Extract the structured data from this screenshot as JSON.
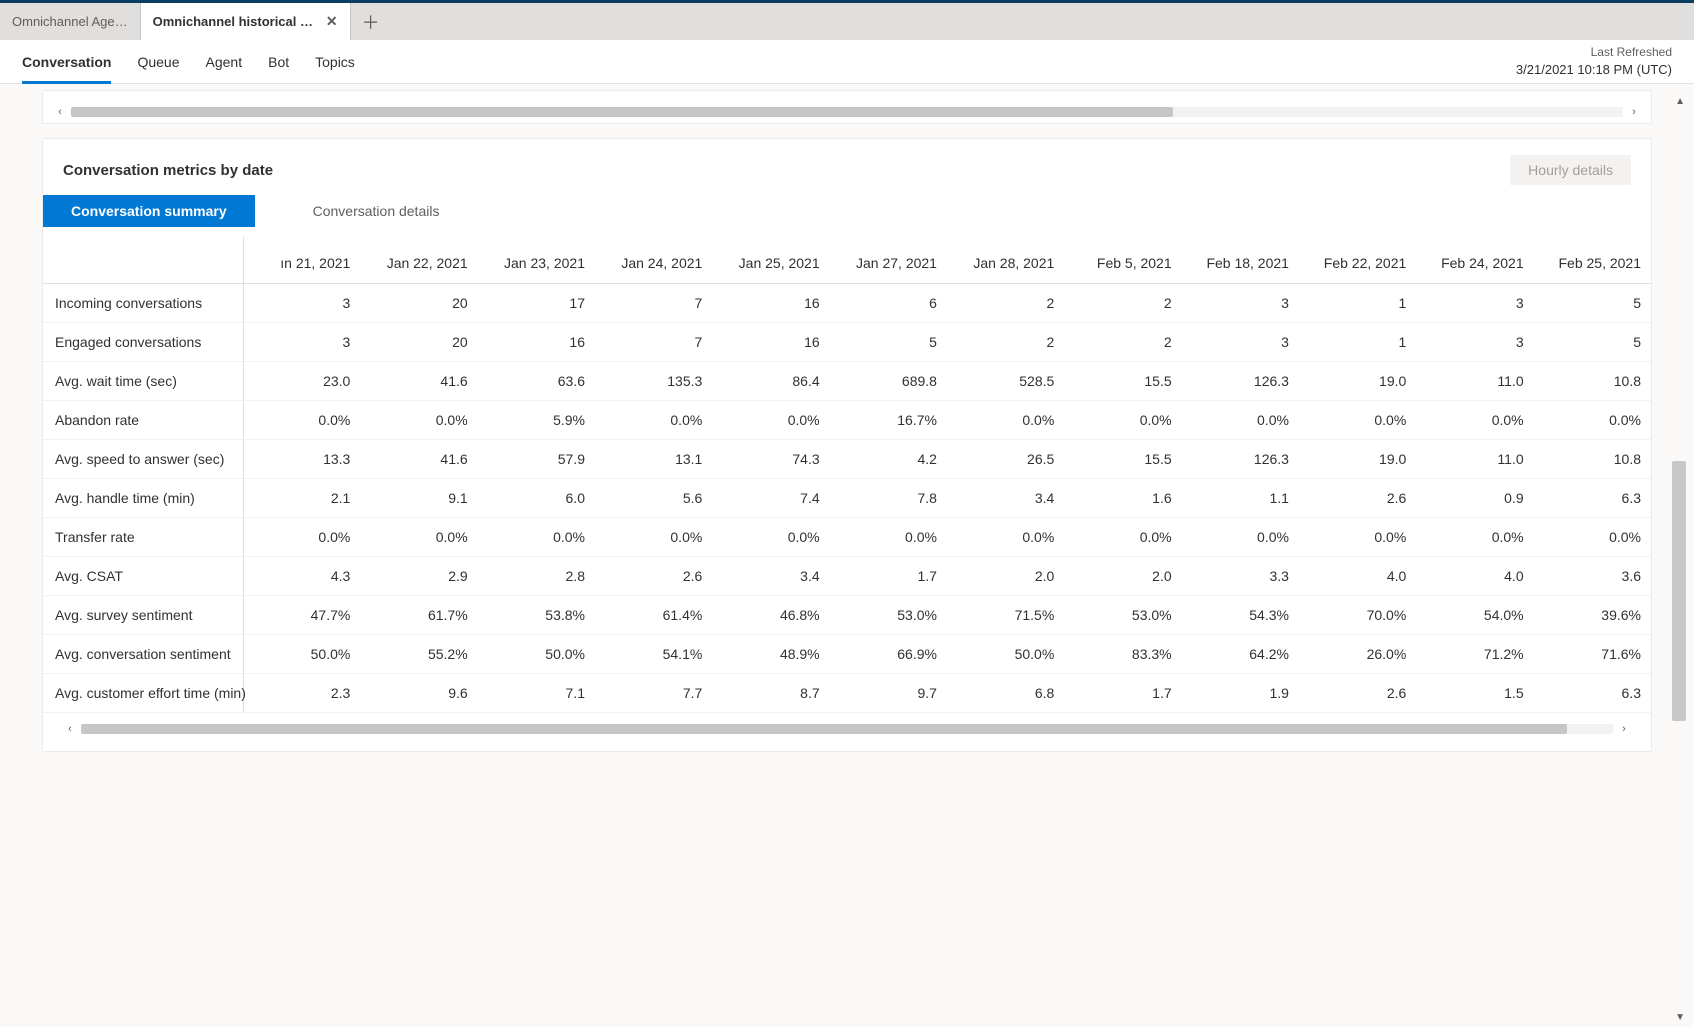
{
  "tabs": [
    {
      "label": "Omnichannel Age…",
      "active": false,
      "closable": false
    },
    {
      "label": "Omnichannel historical an…",
      "active": true,
      "closable": true
    }
  ],
  "nav": {
    "items": [
      "Conversation",
      "Queue",
      "Agent",
      "Bot",
      "Topics"
    ],
    "activeIndex": 0,
    "refreshLabel": "Last Refreshed",
    "refreshTime": "3/21/2021 10:18 PM (UTC)"
  },
  "card": {
    "title": "Conversation metrics by date",
    "hourlyButton": "Hourly details",
    "pivots": [
      "Conversation summary",
      "Conversation details"
    ],
    "activePivot": 0
  },
  "chart_data": {
    "type": "table",
    "columns": [
      "ın 21, 2021",
      "Jan 22, 2021",
      "Jan 23, 2021",
      "Jan 24, 2021",
      "Jan 25, 2021",
      "Jan 27, 2021",
      "Jan 28, 2021",
      "Feb 5, 2021",
      "Feb 18, 2021",
      "Feb 22, 2021",
      "Feb 24, 2021",
      "Feb 25, 2021"
    ],
    "rows": [
      {
        "label": "Incoming conversations",
        "values": [
          "3",
          "20",
          "17",
          "7",
          "16",
          "6",
          "2",
          "2",
          "3",
          "1",
          "3",
          "5"
        ]
      },
      {
        "label": "Engaged conversations",
        "values": [
          "3",
          "20",
          "16",
          "7",
          "16",
          "5",
          "2",
          "2",
          "3",
          "1",
          "3",
          "5"
        ]
      },
      {
        "label": "Avg. wait time (sec)",
        "values": [
          "23.0",
          "41.6",
          "63.6",
          "135.3",
          "86.4",
          "689.8",
          "528.5",
          "15.5",
          "126.3",
          "19.0",
          "11.0",
          "10.8"
        ]
      },
      {
        "label": "Abandon rate",
        "values": [
          "0.0%",
          "0.0%",
          "5.9%",
          "0.0%",
          "0.0%",
          "16.7%",
          "0.0%",
          "0.0%",
          "0.0%",
          "0.0%",
          "0.0%",
          "0.0%"
        ]
      },
      {
        "label": "Avg. speed to answer (sec)",
        "values": [
          "13.3",
          "41.6",
          "57.9",
          "13.1",
          "74.3",
          "4.2",
          "26.5",
          "15.5",
          "126.3",
          "19.0",
          "11.0",
          "10.8"
        ]
      },
      {
        "label": "Avg. handle time (min)",
        "values": [
          "2.1",
          "9.1",
          "6.0",
          "5.6",
          "7.4",
          "7.8",
          "3.4",
          "1.6",
          "1.1",
          "2.6",
          "0.9",
          "6.3"
        ]
      },
      {
        "label": "Transfer rate",
        "values": [
          "0.0%",
          "0.0%",
          "0.0%",
          "0.0%",
          "0.0%",
          "0.0%",
          "0.0%",
          "0.0%",
          "0.0%",
          "0.0%",
          "0.0%",
          "0.0%"
        ]
      },
      {
        "label": "Avg. CSAT",
        "values": [
          "4.3",
          "2.9",
          "2.8",
          "2.6",
          "3.4",
          "1.7",
          "2.0",
          "2.0",
          "3.3",
          "4.0",
          "4.0",
          "3.6"
        ]
      },
      {
        "label": "Avg. survey sentiment",
        "values": [
          "47.7%",
          "61.7%",
          "53.8%",
          "61.4%",
          "46.8%",
          "53.0%",
          "71.5%",
          "53.0%",
          "54.3%",
          "70.0%",
          "54.0%",
          "39.6%"
        ]
      },
      {
        "label": "Avg. conversation sentiment",
        "values": [
          "50.0%",
          "55.2%",
          "50.0%",
          "54.1%",
          "48.9%",
          "66.9%",
          "50.0%",
          "83.3%",
          "64.2%",
          "26.0%",
          "71.2%",
          "71.6%"
        ]
      },
      {
        "label": "Avg. customer effort time (min)",
        "values": [
          "2.3",
          "9.6",
          "7.1",
          "7.7",
          "8.7",
          "9.7",
          "6.8",
          "1.7",
          "1.9",
          "2.6",
          "1.5",
          "6.3"
        ]
      }
    ]
  },
  "scroll": {
    "topThumbWidthPct": 71,
    "bottomThumbWidthPct": 97
  }
}
